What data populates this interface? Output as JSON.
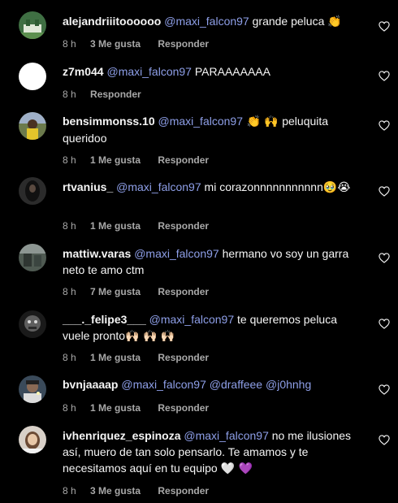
{
  "comments": [
    {
      "username": "alejandriiitoooooo",
      "mention": "@maxi_falcon97",
      "text": " grande peluca ",
      "emoji": "👏",
      "time": "8 h",
      "likes": "3 Me gusta",
      "reply": "Responder"
    },
    {
      "username": "z7m044",
      "mention": "@maxi_falcon97",
      "text": " PARAAAAAAA",
      "time": "8 h",
      "reply": "Responder"
    },
    {
      "username": "bensimmonss.10",
      "mention": "@maxi_falcon97",
      "emoji": " 👏 🙌 ",
      "text": " peluquita queridoo",
      "time": "8 h",
      "likes": "1 Me gusta",
      "reply": "Responder"
    },
    {
      "username": "rtvanius_",
      "mention": "@maxi_falcon97",
      "text": " mi corazonnnnnnnnnnn",
      "emoji": "🥹😭",
      "time": "8 h",
      "likes": "1 Me gusta",
      "reply": "Responder"
    },
    {
      "username": "mattiw.varas",
      "mention": "@maxi_falcon97",
      "text": " hermano vo soy un garra neto te amo ctm",
      "time": "8 h",
      "likes": "7 Me gusta",
      "reply": "Responder"
    },
    {
      "username": "___._felipe3___",
      "mention": "@maxi_falcon97",
      "text": " te queremos peluca vuele pronto",
      "emoji": "🙌🏻 🙌🏻 🙌🏻",
      "time": "8 h",
      "likes": "1 Me gusta",
      "reply": "Responder"
    },
    {
      "username": "bvnjaaaap",
      "mention": "@maxi_falcon97",
      "mention2": "@draffeee",
      "mention3": "@j0hnhg",
      "time": "8 h",
      "likes": "1 Me gusta",
      "reply": "Responder"
    },
    {
      "username": "ivhenriquez_espinoza",
      "mention": "@maxi_falcon97",
      "text": " no me ilusiones así, muero de tan solo pensarlo. Te amamos y te necesitamos aquí en tu equipo ",
      "emoji": "🤍 💜",
      "time": "8 h",
      "likes": "3 Me gusta",
      "reply": "Responder"
    }
  ],
  "colors": {
    "background": "#000000",
    "text": "#f5f5f5",
    "mention": "#8e9fe8",
    "meta": "#a8a8a8"
  },
  "icons": {
    "like": "heart-outline-icon"
  }
}
